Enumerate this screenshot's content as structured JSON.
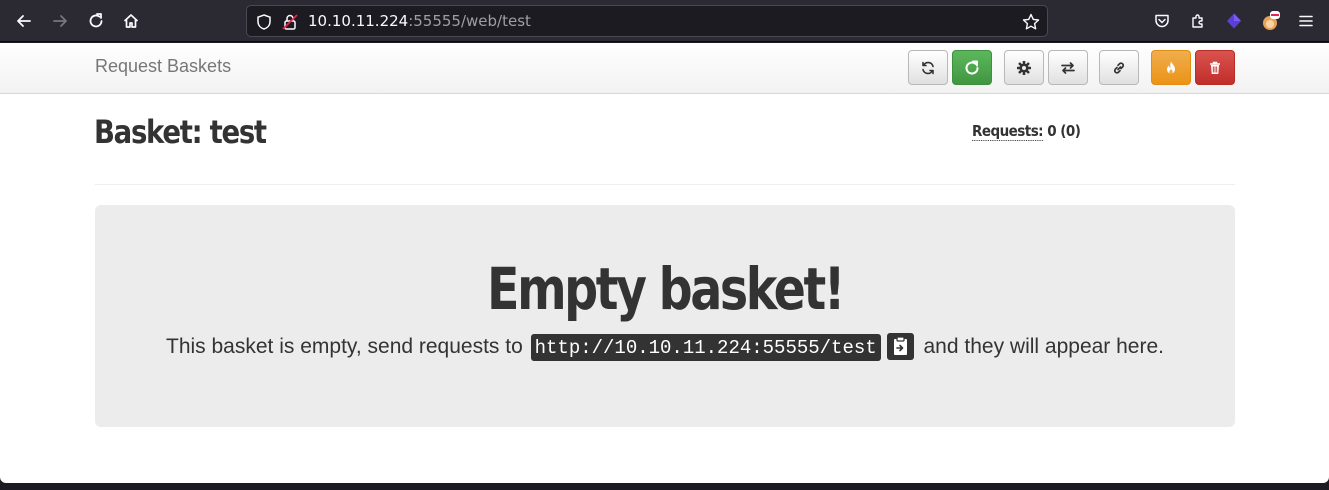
{
  "browser": {
    "url_host": "10.10.11.224",
    "url_rest": ":55555/web/test"
  },
  "navbar": {
    "brand": "Request Baskets"
  },
  "header": {
    "basket_title": "Basket: test",
    "requests_label": "Requests:",
    "requests_value": " 0 (0)"
  },
  "jumbotron": {
    "title": "Empty basket!",
    "text_before": "This basket is empty, send requests to ",
    "basket_url": "http://10.10.11.224:55555/test",
    "text_after": " and they will appear here."
  },
  "colors": {
    "green": "#5cb85c",
    "orange": "#f0ad4e",
    "red": "#d9534f"
  }
}
